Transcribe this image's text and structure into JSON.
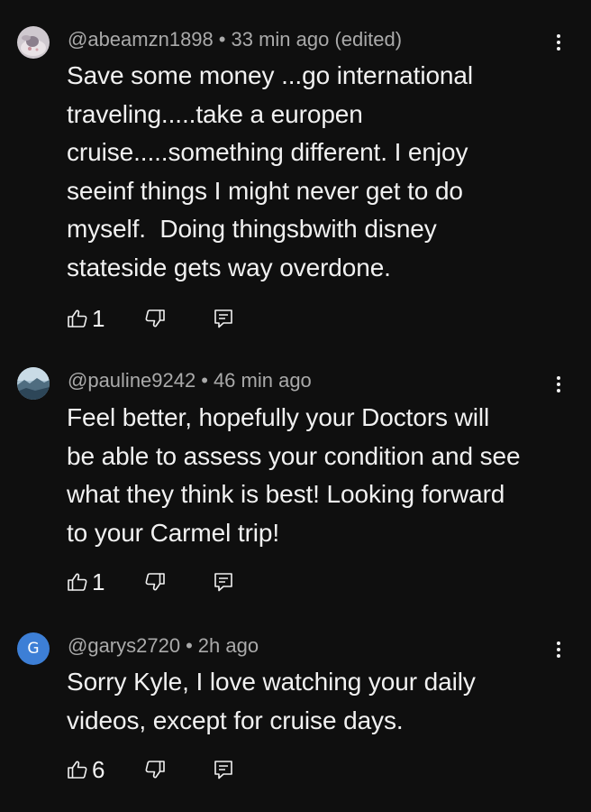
{
  "comments": [
    {
      "handle": "@abeamzn1898",
      "separator": "•",
      "time": "33 min ago (edited)",
      "text": "Save some money ...go international\ntraveling.....take a europen\ncruise.....something different. I enjoy\nseeinf things I might never get to do\nmyself.  Doing thingsbwith disney\nstateside gets way overdone.",
      "likes": "1",
      "avatar_icon": "photo-avatar-icon"
    },
    {
      "handle": "@pauline9242",
      "separator": "•",
      "time": "46 min ago",
      "text": "Feel better, hopefully your Doctors will\nbe able to assess your condition and see\nwhat they think is best! Looking forward\nto your Carmel trip!",
      "likes": "1",
      "avatar_icon": "landscape-avatar-icon"
    },
    {
      "handle": "@garys2720",
      "separator": "•",
      "time": "2h ago",
      "text": "Sorry Kyle, I love watching your daily\nvideos, except for cruise days.",
      "likes": "6",
      "avatar_letter": "G",
      "avatar_color": "#3d7fd6"
    }
  ],
  "icons": {
    "like": "thumbs-up-icon",
    "dislike": "thumbs-down-icon",
    "reply": "reply-comment-icon",
    "menu": "more-vertical-icon"
  },
  "colors": {
    "background": "#0f0f0f",
    "text": "#f1f1f1",
    "meta": "#aaaaaa"
  }
}
